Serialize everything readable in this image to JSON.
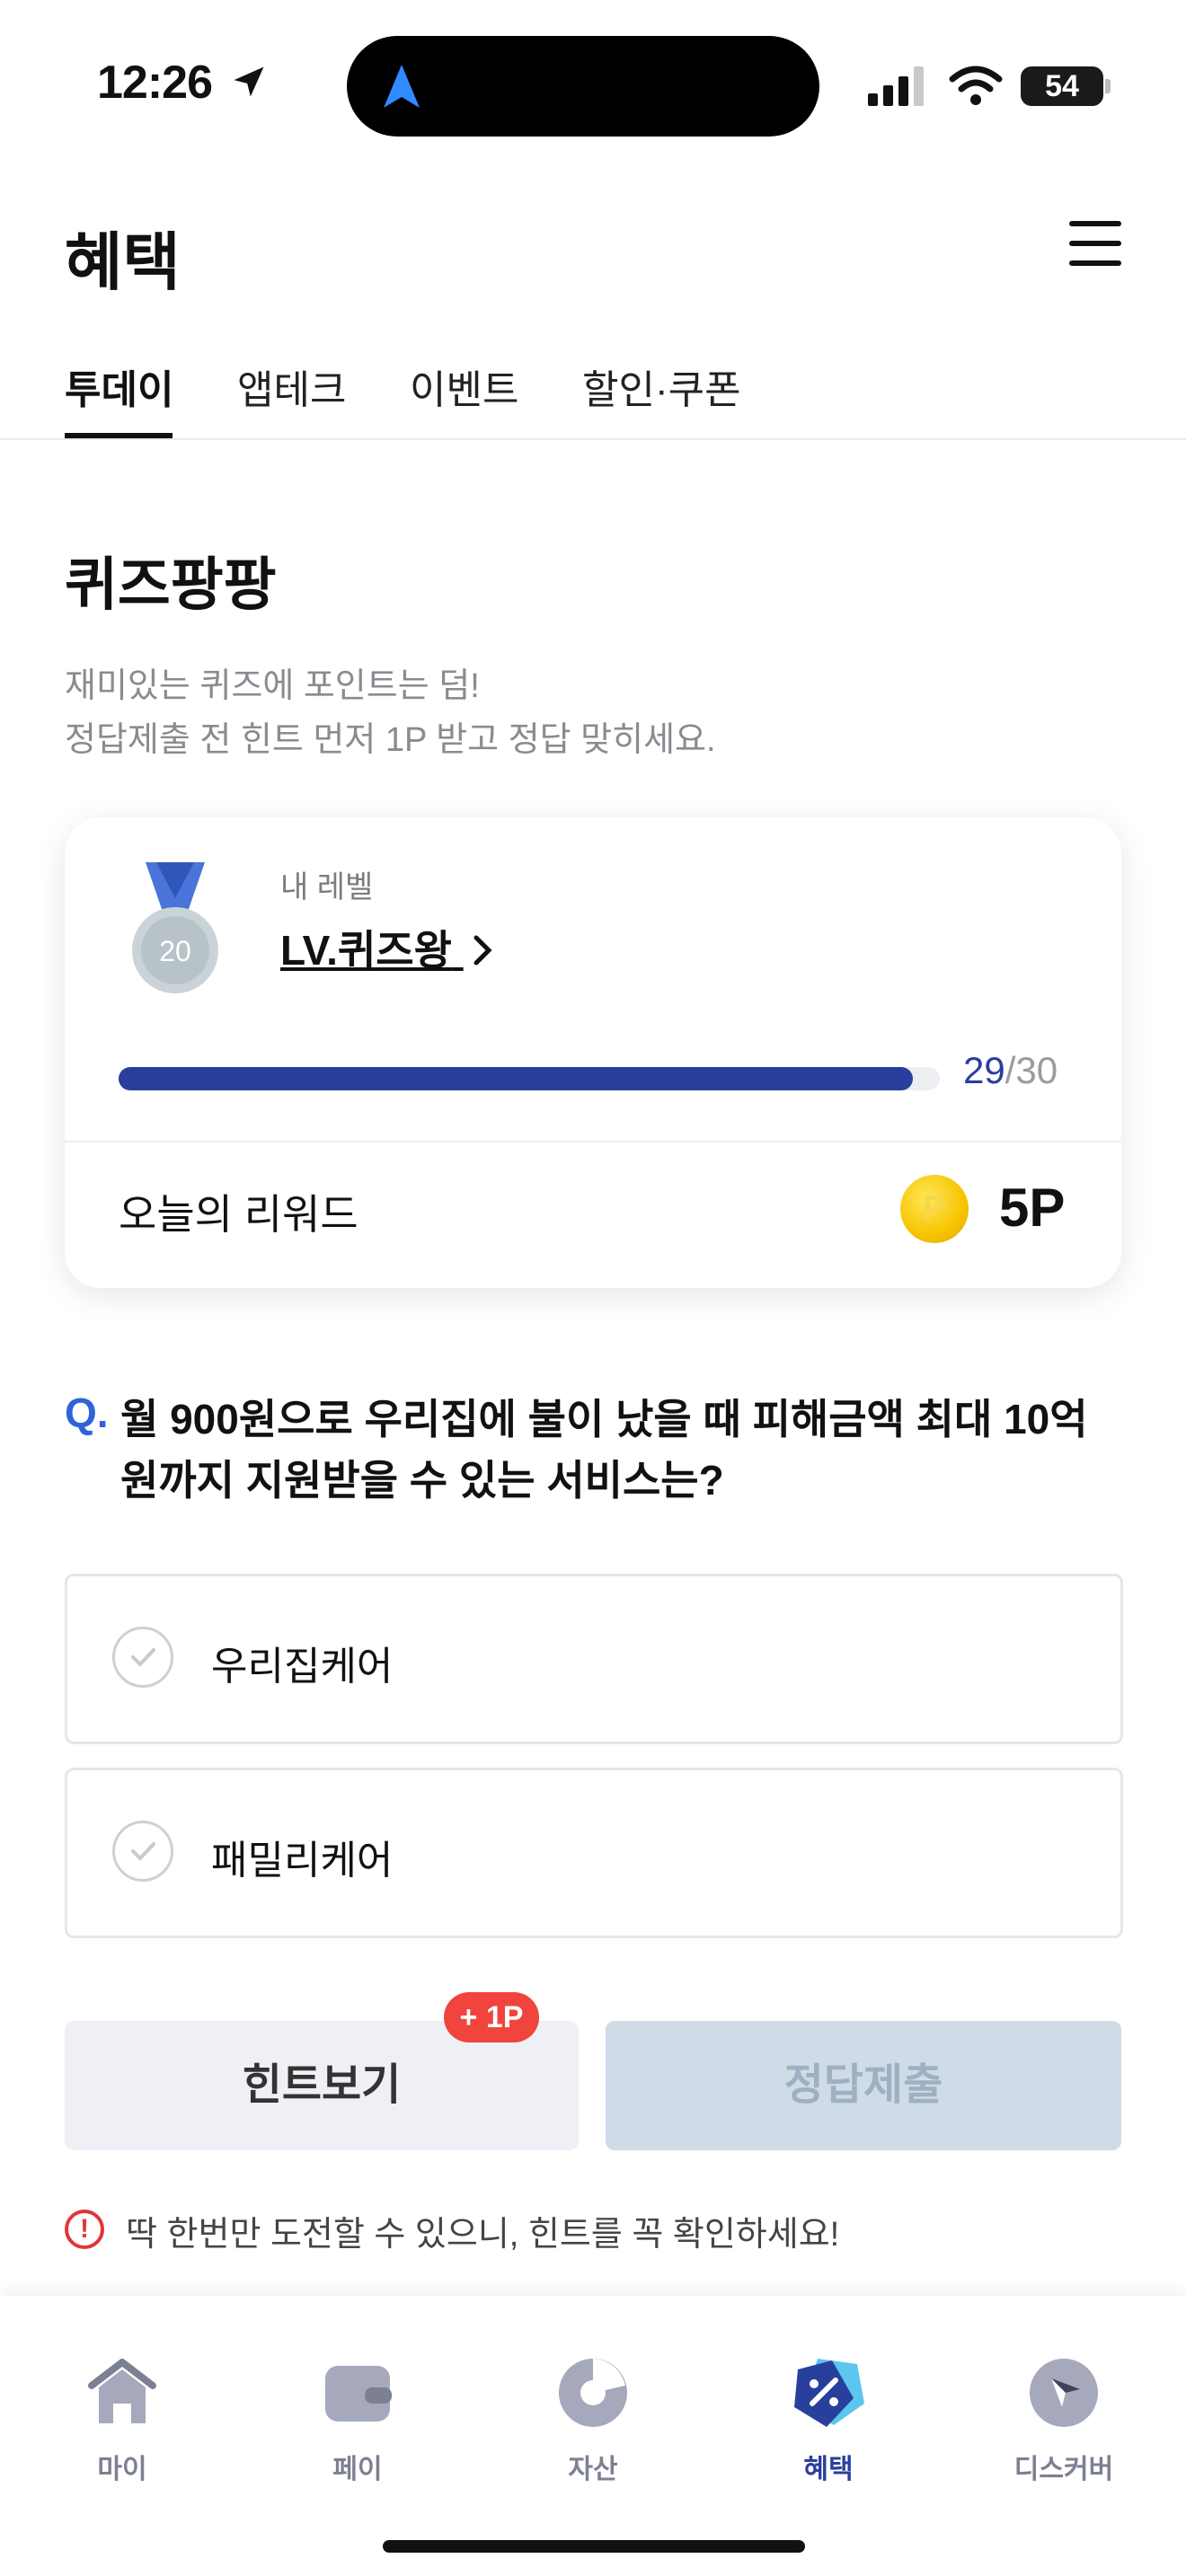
{
  "status_bar": {
    "time": "12:26",
    "battery": "54"
  },
  "header": {
    "title": "혜택"
  },
  "tabs": [
    {
      "label": "투데이"
    },
    {
      "label": "앱테크"
    },
    {
      "label": "이벤트"
    },
    {
      "label": "할인·쿠폰"
    }
  ],
  "quiz": {
    "title": "퀴즈팡팡",
    "desc_line1": "재미있는 퀴즈에 포인트는 덤!",
    "desc_line2": "정답제출 전 힌트 먼저 1P 받고 정답 맞히세요."
  },
  "level_card": {
    "medal_number": "20",
    "label": "내 레벨",
    "level_name": "LV.퀴즈왕",
    "progress_current": "29",
    "progress_total": "/30",
    "progress_fraction": 0.9667,
    "reward_label": "오늘의 리워드",
    "coin_letter": "P",
    "reward_value": "5P"
  },
  "question": {
    "q_mark": "Q.",
    "text": "월 900원으로 우리집에 불이 났을 때 피해금액 최대 10억원까지 지원받을 수 있는 서비스는?",
    "options": [
      {
        "label": "우리집케어"
      },
      {
        "label": "패밀리케어"
      }
    ]
  },
  "actions": {
    "hint_label": "힌트보기",
    "hint_badge": "+ 1P",
    "submit_label": "정답제출"
  },
  "notice": {
    "icon": "!",
    "text": "딱 한번만 도전할 수 있으니, 힌트를 꼭 확인하세요!"
  },
  "bottom_nav": [
    {
      "label": "마이",
      "icon": "home-icon"
    },
    {
      "label": "페이",
      "icon": "wallet-icon"
    },
    {
      "label": "자산",
      "icon": "pie-chart-icon"
    },
    {
      "label": "혜택",
      "icon": "benefit-tag-icon",
      "active": true
    },
    {
      "label": "디스커버",
      "icon": "compass-icon"
    }
  ],
  "colors": {
    "accent": "#293f9c",
    "alert": "#f0443c",
    "question": "#2f63d8"
  }
}
